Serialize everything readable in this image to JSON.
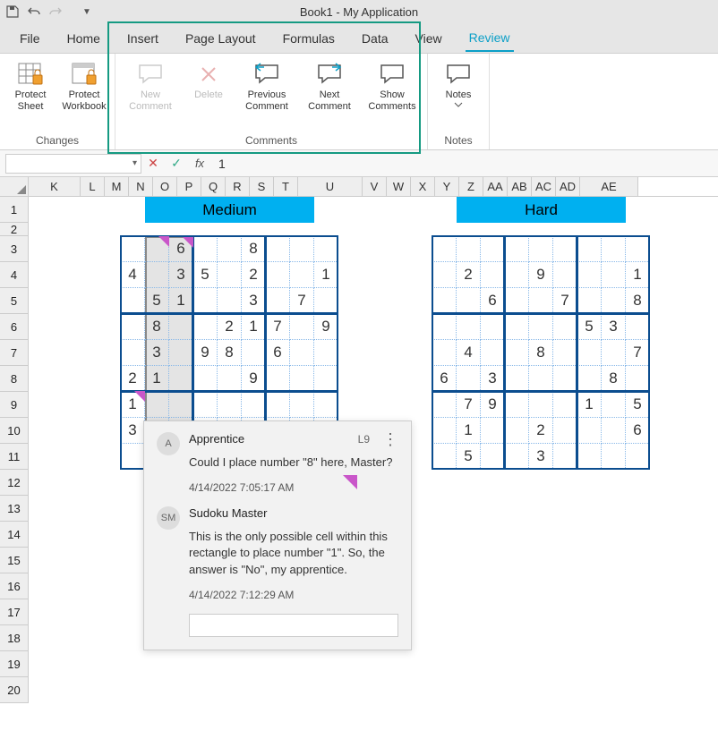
{
  "app_title": "Book1 - My Application",
  "qat": {
    "save": "save-icon",
    "undo": "undo-icon",
    "redo": "redo-icon",
    "more": "▾"
  },
  "tabs": [
    "File",
    "Home",
    "Insert",
    "Page Layout",
    "Formulas",
    "Data",
    "View",
    "Review"
  ],
  "active_tab": "Review",
  "ribbon": {
    "changes": {
      "label": "Changes",
      "items": [
        {
          "id": "protect-sheet",
          "label": "Protect Sheet"
        },
        {
          "id": "protect-workbook",
          "label": "Protect Workbook"
        }
      ]
    },
    "comments": {
      "label": "Comments",
      "items": [
        {
          "id": "new-comment",
          "label": "New Comment",
          "disabled": true
        },
        {
          "id": "delete-comment",
          "label": "Delete",
          "disabled": true
        },
        {
          "id": "prev-comment",
          "label": "Previous Comment"
        },
        {
          "id": "next-comment",
          "label": "Next Comment"
        },
        {
          "id": "show-comments",
          "label": "Show Comments"
        }
      ]
    },
    "notes": {
      "label": "Notes",
      "items": [
        {
          "id": "notes",
          "label": "Notes"
        }
      ]
    }
  },
  "formula_bar": {
    "namebox": "",
    "value": "1"
  },
  "columns": [
    "K",
    "L",
    "M",
    "N",
    "O",
    "P",
    "Q",
    "R",
    "S",
    "T",
    "U",
    "V",
    "W",
    "X",
    "Y",
    "Z",
    "AA",
    "AB",
    "AC",
    "AD",
    "AE"
  ],
  "rows": [
    1,
    2,
    3,
    4,
    5,
    6,
    7,
    8,
    9,
    10,
    11,
    12,
    13,
    14,
    15,
    16,
    17,
    18,
    19,
    20
  ],
  "sudoku_medium": {
    "title": "Medium",
    "grid": [
      [
        "",
        "",
        "6",
        "",
        "",
        "8",
        "",
        "",
        ""
      ],
      [
        "4",
        "",
        "3",
        "5",
        "",
        "2",
        "",
        "",
        "1"
      ],
      [
        "",
        "5",
        "1",
        "",
        "",
        "3",
        "",
        "7",
        ""
      ],
      [
        "",
        "8",
        "",
        "",
        "2",
        "1",
        "7",
        "",
        "9"
      ],
      [
        "",
        "3",
        "",
        "9",
        "8",
        "",
        "6",
        "",
        ""
      ],
      [
        "2",
        "1",
        "",
        "",
        "",
        "9",
        "",
        "",
        ""
      ],
      [
        "1",
        "",
        "",
        "",
        "",
        "",
        "",
        "",
        ""
      ],
      [
        "3",
        "",
        "",
        "",
        "",
        "",
        "",
        "",
        ""
      ],
      [
        "",
        "",
        "",
        "",
        "",
        "",
        "",
        "",
        ""
      ]
    ]
  },
  "sudoku_hard": {
    "title": "Hard",
    "grid": [
      [
        "",
        "",
        "",
        "",
        "",
        "",
        "",
        "",
        ""
      ],
      [
        "",
        "2",
        "",
        "",
        "9",
        "",
        "",
        "",
        "1"
      ],
      [
        "",
        "",
        "6",
        "",
        "",
        "7",
        "",
        "",
        "8"
      ],
      [
        "",
        "",
        "",
        "",
        "",
        "",
        "5",
        "3",
        ""
      ],
      [
        "",
        "4",
        "",
        "",
        "8",
        "",
        "",
        "",
        "7"
      ],
      [
        "6",
        "",
        "3",
        "",
        "",
        "",
        "",
        "8",
        ""
      ],
      [
        "",
        "7",
        "9",
        "",
        "",
        "",
        "1",
        "",
        "5"
      ],
      [
        "",
        "1",
        "",
        "",
        "2",
        "",
        "",
        "",
        "6"
      ],
      [
        "",
        "5",
        "",
        "",
        "3",
        "",
        "",
        "",
        ""
      ]
    ]
  },
  "comment": {
    "cell": "L9",
    "thread": [
      {
        "avatar": "A",
        "author": "Apprentice",
        "text": "Could I place number \"8\" here, Master?",
        "time": "4/14/2022 7:05:17 AM"
      },
      {
        "avatar": "SM",
        "author": "Sudoku Master",
        "text": "This is the only possible cell within this rectangle to place number \"1\". So, the answer is \"No\", my apprentice.",
        "time": "4/14/2022 7:12:29 AM"
      }
    ]
  }
}
